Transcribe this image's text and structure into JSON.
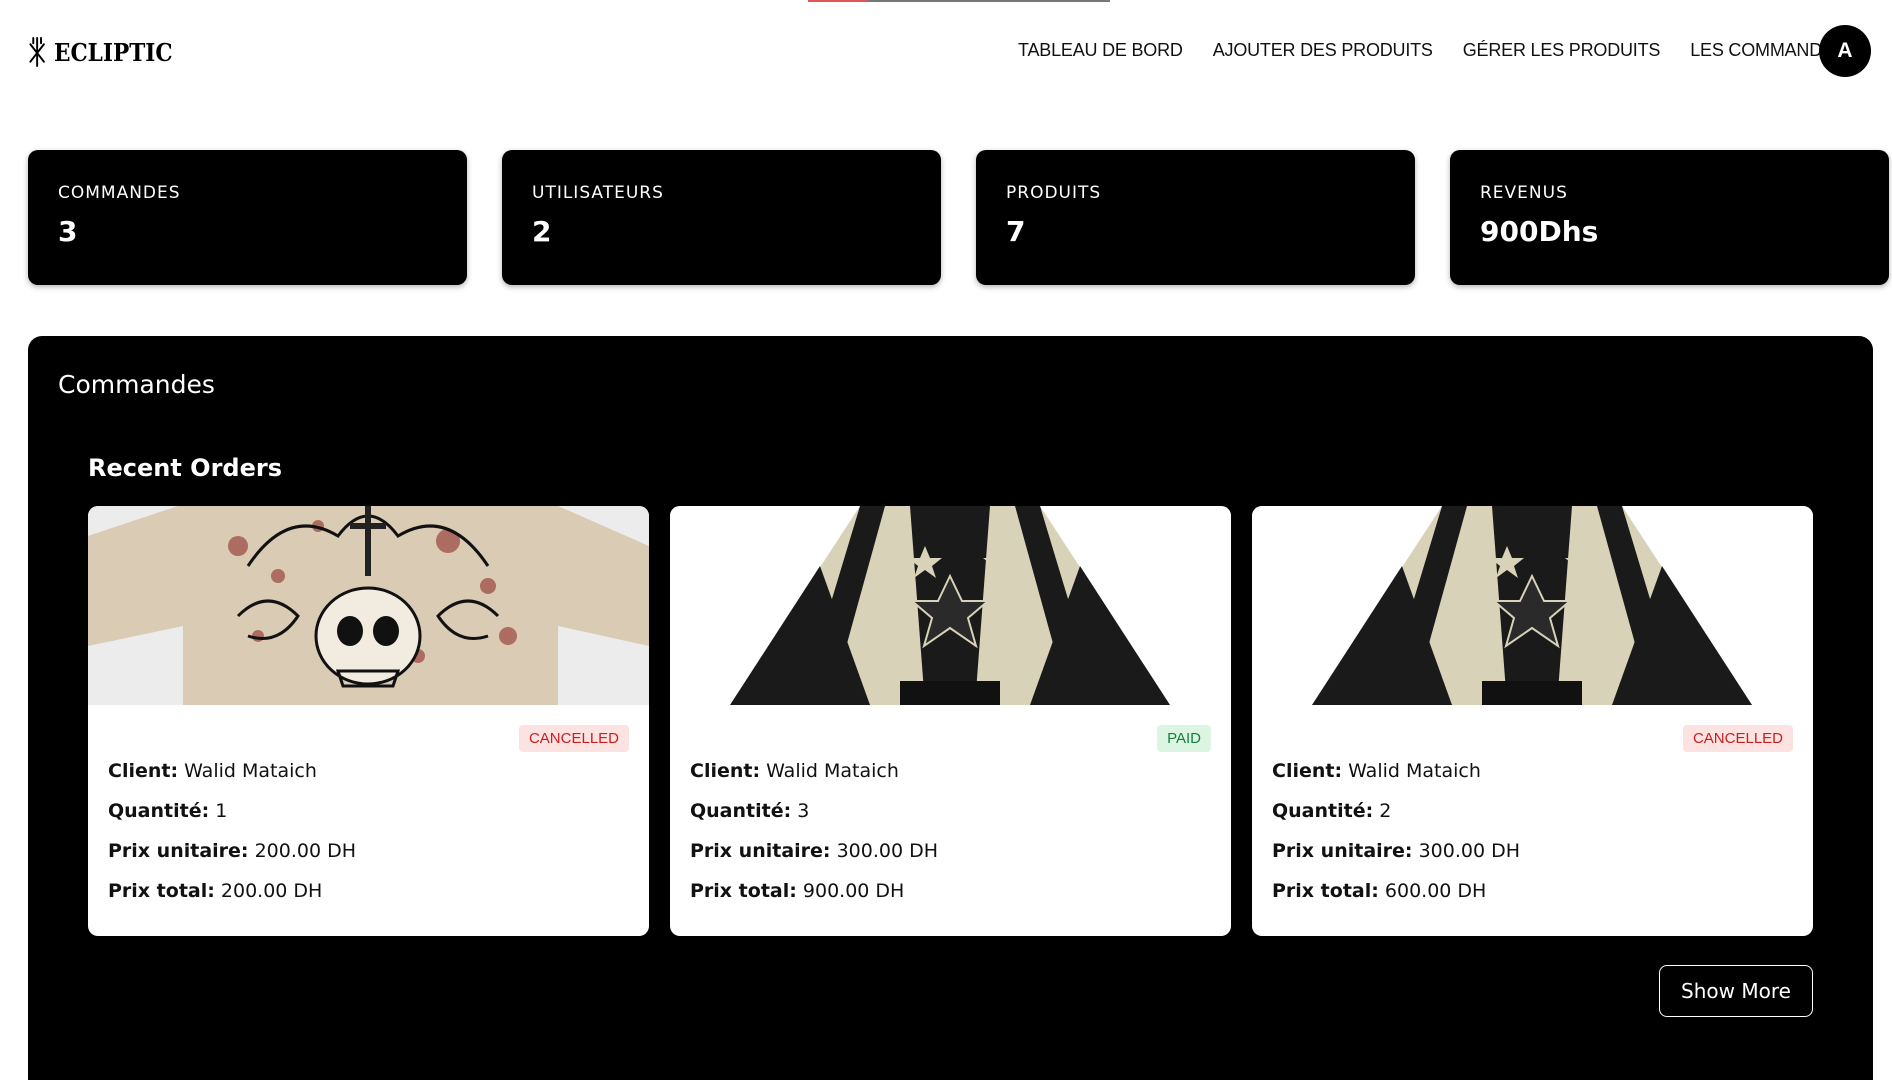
{
  "brand": {
    "name": "ECLIPTIC"
  },
  "loading_progress": 0.2,
  "nav": {
    "items": [
      {
        "label": "TABLEAU DE BORD"
      },
      {
        "label": "AJOUTER DES PRODUITS"
      },
      {
        "label": "GÉRER LES PRODUITS"
      },
      {
        "label": "LES COMMANDES"
      }
    ],
    "avatar_initial": "A"
  },
  "stats": [
    {
      "label": "COMMANDES",
      "value": "3"
    },
    {
      "label": "UTILISATEURS",
      "value": "2"
    },
    {
      "label": "PRODUITS",
      "value": "7"
    },
    {
      "label": "REVENUS",
      "value": "900Dhs"
    }
  ],
  "panel": {
    "title": "Commandes",
    "recent_title": "Recent Orders",
    "show_more_label": "Show More"
  },
  "labels": {
    "client": "Client:",
    "quantity": "Quantité:",
    "unit_price": "Prix unitaire:",
    "total_price": "Prix total:"
  },
  "orders": [
    {
      "image": "skull-tshirt",
      "status": "CANCELLED",
      "status_kind": "cancelled",
      "client": "Walid Mataich",
      "quantity": "1",
      "unit_price": "200.00 DH",
      "total_price": "200.00 DH"
    },
    {
      "image": "star-hoodie",
      "status": "PAID",
      "status_kind": "paid",
      "client": "Walid Mataich",
      "quantity": "3",
      "unit_price": "300.00 DH",
      "total_price": "900.00 DH"
    },
    {
      "image": "star-hoodie",
      "status": "CANCELLED",
      "status_kind": "cancelled",
      "client": "Walid Mataich",
      "quantity": "2",
      "unit_price": "300.00 DH",
      "total_price": "600.00 DH"
    }
  ],
  "colors": {
    "card_bg": "#000000",
    "cancelled_bg": "#fde2e2",
    "cancelled_text": "#c81e1e",
    "paid_bg": "#dcf5e3",
    "paid_text": "#15803d",
    "progress": "#e05555"
  }
}
